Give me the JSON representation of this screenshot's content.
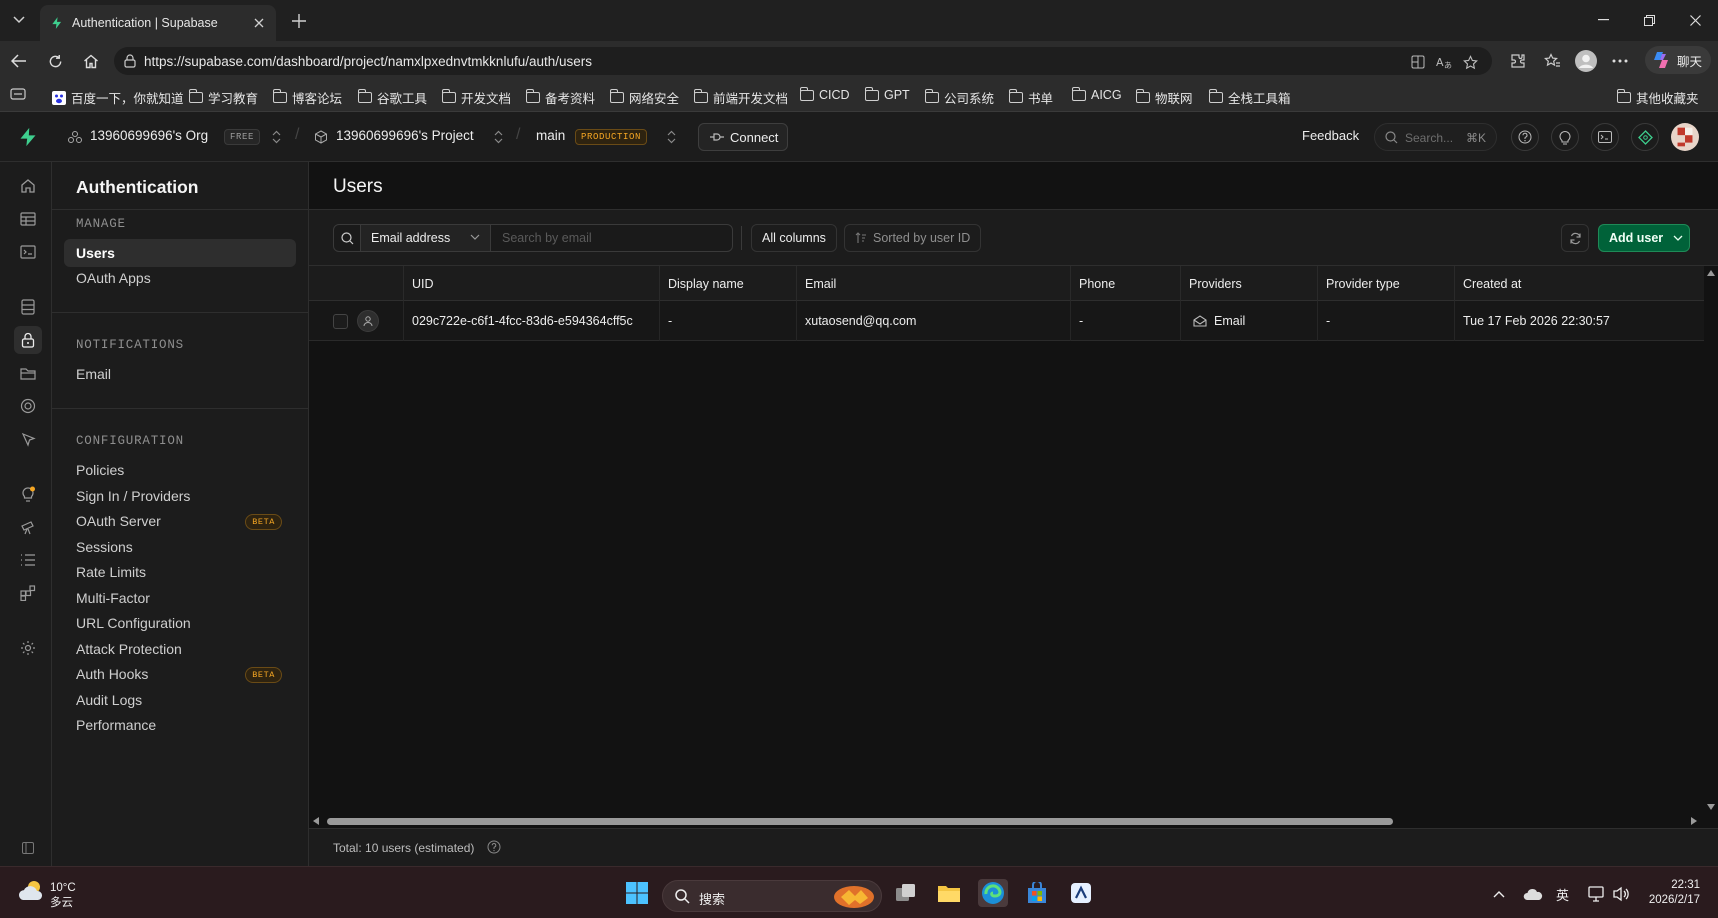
{
  "browser": {
    "tab_title": "Authentication | Supabase",
    "url": "https://supabase.com/dashboard/project/namxlpxednvtmkknlufu/auth/users",
    "chat_label": "聊天"
  },
  "bookmarks": [
    {
      "label": "百度一下，你就知道",
      "icon": "baidu-icon"
    },
    {
      "label": "学习教育",
      "icon": "folder-icon"
    },
    {
      "label": "博客论坛",
      "icon": "folder-icon"
    },
    {
      "label": "谷歌工具",
      "icon": "folder-icon"
    },
    {
      "label": "开发文档",
      "icon": "folder-icon"
    },
    {
      "label": "备考资料",
      "icon": "folder-icon"
    },
    {
      "label": "网络安全",
      "icon": "folder-icon"
    },
    {
      "label": "前端开发文档",
      "icon": "folder-icon"
    },
    {
      "label": "CICD",
      "icon": "folder-icon"
    },
    {
      "label": "GPT",
      "icon": "folder-icon"
    },
    {
      "label": "公司系统",
      "icon": "folder-icon"
    },
    {
      "label": "书单",
      "icon": "folder-icon"
    },
    {
      "label": "AICG",
      "icon": "folder-icon"
    },
    {
      "label": "物联网",
      "icon": "folder-icon"
    },
    {
      "label": "全栈工具箱",
      "icon": "folder-icon"
    }
  ],
  "other_bookmarks": "其他收藏夹",
  "header": {
    "org": "13960699696's Org",
    "org_badge": "FREE",
    "project": "13960699696's Project",
    "branch": "main",
    "branch_badge": "PRODUCTION",
    "connect": "Connect",
    "feedback": "Feedback",
    "search_placeholder": "Search...",
    "search_shortcut": "⌘K"
  },
  "menu": {
    "title": "Authentication",
    "sections": [
      {
        "title": "MANAGE",
        "items": [
          {
            "label": "Users",
            "active": true
          },
          {
            "label": "OAuth Apps"
          }
        ]
      },
      {
        "title": "NOTIFICATIONS",
        "items": [
          {
            "label": "Email"
          }
        ]
      },
      {
        "title": "CONFIGURATION",
        "items": [
          {
            "label": "Policies"
          },
          {
            "label": "Sign In / Providers"
          },
          {
            "label": "OAuth Server",
            "badge": "BETA"
          },
          {
            "label": "Sessions"
          },
          {
            "label": "Rate Limits"
          },
          {
            "label": "Multi-Factor"
          },
          {
            "label": "URL Configuration"
          },
          {
            "label": "Attack Protection"
          },
          {
            "label": "Auth Hooks",
            "badge": "BETA"
          },
          {
            "label": "Audit Logs"
          },
          {
            "label": "Performance"
          }
        ]
      }
    ]
  },
  "main": {
    "title": "Users",
    "search_field": "Email address",
    "search_placeholder": "Search by email",
    "all_columns": "All columns",
    "sorted_by": "Sorted by user ID",
    "add_user": "Add user",
    "columns": [
      "UID",
      "Display name",
      "Email",
      "Phone",
      "Providers",
      "Provider type",
      "Created at"
    ],
    "rows": [
      {
        "uid": "029c722e-c6f1-4fcc-83d6-e594364cff5c",
        "display_name": "-",
        "email": "xutaosend@qq.com",
        "phone": "-",
        "provider": "Email",
        "provider_type": "-",
        "created_at": "Tue 17 Feb 2026 22:30:57"
      }
    ],
    "total": "Total: 10 users (estimated)"
  },
  "taskbar": {
    "temp": "10°C",
    "weather": "多云",
    "search": "搜索",
    "ime": "英",
    "time": "22:31",
    "date": "2026/2/17"
  },
  "colors": {
    "accent_green": "#3ecf8e",
    "add_user_bg": "#006239",
    "badge_orange": "#f5a623"
  }
}
